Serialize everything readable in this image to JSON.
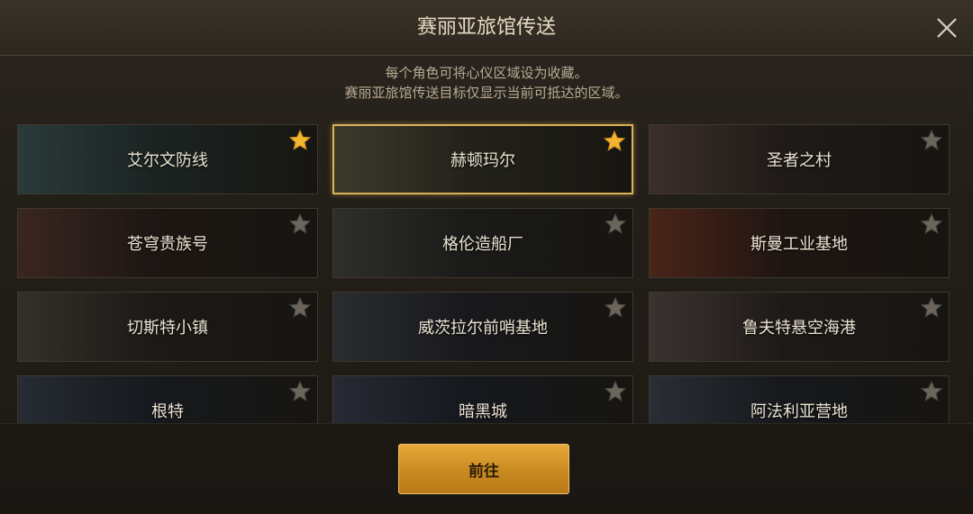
{
  "dialog": {
    "title": "赛丽亚旅馆传送",
    "hint_line1": "每个角色可将心仪区域设为收藏。",
    "hint_line2": "赛丽亚旅馆传送目标仅显示当前可抵达的区域。",
    "confirm_label": "前往"
  },
  "colors": {
    "star_active": "#f2b431",
    "star_inactive": "#6b655b",
    "selected_border": "#d9b25a",
    "button": "#d6972a"
  },
  "locations": [
    {
      "name": "艾尔文防线",
      "favorited": true,
      "selected": false
    },
    {
      "name": "赫顿玛尔",
      "favorited": true,
      "selected": true
    },
    {
      "name": "圣者之村",
      "favorited": false,
      "selected": false
    },
    {
      "name": "苍穹贵族号",
      "favorited": false,
      "selected": false
    },
    {
      "name": "格伦造船厂",
      "favorited": false,
      "selected": false
    },
    {
      "name": "斯曼工业基地",
      "favorited": false,
      "selected": false
    },
    {
      "name": "切斯特小镇",
      "favorited": false,
      "selected": false
    },
    {
      "name": "威茨拉尔前哨基地",
      "favorited": false,
      "selected": false
    },
    {
      "name": "鲁夫特悬空海港",
      "favorited": false,
      "selected": false
    },
    {
      "name": "根特",
      "favorited": false,
      "selected": false
    },
    {
      "name": "暗黑城",
      "favorited": false,
      "selected": false
    },
    {
      "name": "阿法利亚营地",
      "favorited": false,
      "selected": false
    }
  ]
}
